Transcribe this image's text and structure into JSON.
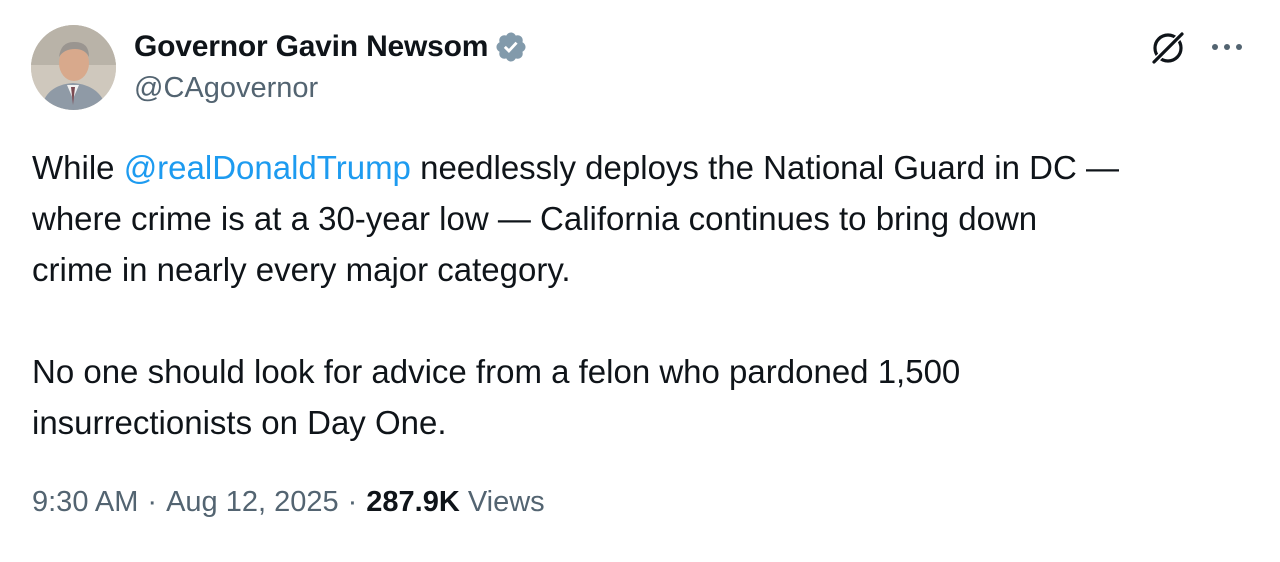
{
  "author": {
    "display_name": "Governor Gavin Newsom",
    "handle": "@CAgovernor",
    "verified_icon": "verified-badge-gray"
  },
  "actions": {
    "grok_icon": "grok-icon",
    "more_icon": "more-horizontal-icon"
  },
  "tweet": {
    "text_before_mention": "While ",
    "mention": "@realDonaldTrump",
    "text_after_mention_line1": " needlessly deploys the National Guard in DC —",
    "line2": "where crime is at a 30-year low — California continues to bring down",
    "line3": "crime in nearly every major category.",
    "line4": "No one should look for advice from a felon who pardoned 1,500",
    "line5": "insurrectionists on Day One."
  },
  "meta": {
    "time": "9:30 AM",
    "separator": "·",
    "date": "Aug 12, 2025",
    "views_count": "287.9K",
    "views_label": "Views"
  },
  "colors": {
    "text_primary": "#0f1419",
    "text_secondary": "#536471",
    "mention_blue": "#1d9bf0",
    "badge_gray": "#829aab"
  }
}
